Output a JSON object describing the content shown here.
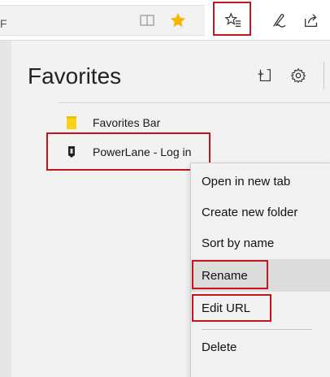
{
  "toolbar": {
    "address_fragment": "F",
    "icons": [
      "reading-view-icon",
      "favorite-star-icon",
      "favorites-hub-icon",
      "web-note-icon",
      "share-icon"
    ]
  },
  "hub": {
    "title": "Favorites",
    "header_icons": [
      "import-favorites-icon",
      "gear-icon"
    ],
    "items": [
      {
        "label": "Favorites Bar",
        "icon": "folder-icon"
      },
      {
        "label": "PowerLane - Log in",
        "icon": "site-favicon-icon"
      }
    ]
  },
  "context_menu": {
    "items": [
      {
        "label": "Open in new tab"
      },
      {
        "label": "Create new folder"
      },
      {
        "label": "Sort by name"
      },
      {
        "label": "Rename"
      },
      {
        "label": "Edit URL"
      },
      {
        "label": "Delete"
      }
    ]
  },
  "colors": {
    "highlight": "#c0161f",
    "star": "#f7b500",
    "folder": "#fcd116",
    "panel": "#f2f2f2"
  }
}
